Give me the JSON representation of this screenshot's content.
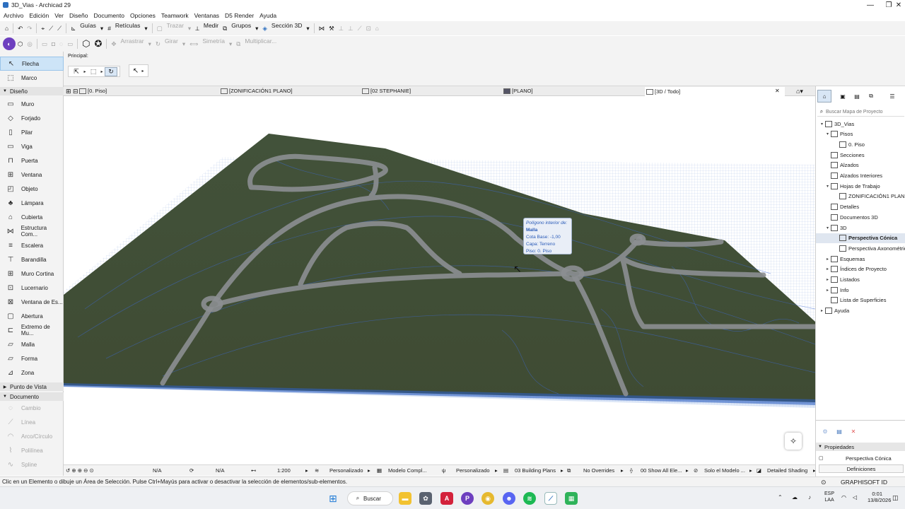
{
  "window": {
    "title": "3D_Vias - Archicad 29",
    "minimize_icon": "minimize-icon",
    "restore_icon": "restore-icon",
    "close_icon": "close-icon"
  },
  "menu": [
    "Archivo",
    "Edición",
    "Ver",
    "Diseño",
    "Documento",
    "Opciones",
    "Teamwork",
    "Ventanas",
    "D5 Render",
    "Ayuda"
  ],
  "toolbar1": {
    "guias": "Guías",
    "reticulas": "Retículas",
    "trazar": "Trazar",
    "medir": "Medir",
    "grupos": "Grupos",
    "seccion3d": "Sección 3D"
  },
  "toolbar2": {
    "arrastrar": "Arrastrar",
    "girar": "Girar",
    "simetria": "Simetría",
    "multiplicar": "Multiplicar..."
  },
  "infobox": {
    "label": "Principal:"
  },
  "toolbox": {
    "flecha": "Flecha",
    "marco": "Marco",
    "diseno_header": "Diseño",
    "design_tools": [
      "Muro",
      "Forjado",
      "Pilar",
      "Viga",
      "Puerta",
      "Ventana",
      "Objeto",
      "Lámpara",
      "Cubierta",
      "Estructura Com...",
      "Escalera",
      "Barandilla",
      "Muro Cortina",
      "Lucernario",
      "Ventana de Es...",
      "Abertura",
      "Extremo de Mu...",
      "Malla",
      "Forma",
      "Zona"
    ],
    "punto_header": "Punto de Vista",
    "documento_header": "Documento",
    "doc_tools": [
      "Cambio",
      "Línea",
      "Arco/Círculo",
      "Polilínea",
      "Spline"
    ]
  },
  "tabs": [
    "[0. Piso]",
    "[ZONIFICACIÓN1 PLANO]",
    "[02 STEPHANIE]",
    "[PLANO]",
    "[3D / Todo]"
  ],
  "tooltip": {
    "line1": "Polígono interior de:",
    "line2": "Malla",
    "line3": "Cota Base: -1,00",
    "line4": "Capa: Terreno",
    "line5": "Piso: 0. Piso"
  },
  "navigator": {
    "search_placeholder": "Buscar Mapa de Proyecto",
    "items": [
      {
        "label": "3D_Vias",
        "exp": "▾"
      },
      {
        "label": "Pisos",
        "exp": "▾"
      },
      {
        "label": "0. Piso",
        "exp": ""
      },
      {
        "label": "Secciones",
        "exp": ""
      },
      {
        "label": "Alzados",
        "exp": ""
      },
      {
        "label": "Alzados Interiores",
        "exp": ""
      },
      {
        "label": "Hojas de Trabajo",
        "exp": "▾"
      },
      {
        "label": "ZONIFICACIÓN1 PLANO (",
        "exp": ""
      },
      {
        "label": "Detalles",
        "exp": ""
      },
      {
        "label": "Documentos 3D",
        "exp": ""
      },
      {
        "label": "3D",
        "exp": "▾"
      },
      {
        "label": "Perspectiva Cónica",
        "exp": ""
      },
      {
        "label": "Perspectiva Axonométrica",
        "exp": ""
      },
      {
        "label": "Esquemas",
        "exp": "▸"
      },
      {
        "label": "Índices de Proyecto",
        "exp": "▸"
      },
      {
        "label": "Listados",
        "exp": "▸"
      },
      {
        "label": "Info",
        "exp": "▸"
      },
      {
        "label": "Lista de Superficies",
        "exp": ""
      },
      {
        "label": "Ayuda",
        "exp": "▸"
      }
    ],
    "properties_header": "Propiedades",
    "properties_value": "Perspectiva Cónica",
    "definitions": "Definiciones",
    "graphisoft_id": "GRAPHISOFT ID"
  },
  "viewcontrols": {
    "na1": "N/A",
    "na2": "N/A",
    "scale": "1:200",
    "pers1": "Personalizado",
    "modelo": "Modelo Compl...",
    "pers2": "Personalizado",
    "building": "03 Building Plans",
    "overrides": "No Overrides",
    "show": "00 Show All Ele...",
    "solo": "Solo el Modelo ...",
    "shading": "Detailed Shading"
  },
  "status": "Clic en un Elemento o dibuje un Área de Selección. Pulse Ctrl+Mayús para activar o desactivar la selección de elementos/sub-elementos.",
  "taskbar": {
    "search": "Buscar",
    "lang1": "ESP",
    "lang2": "LAA",
    "time": "0:01",
    "date": "13/8/2026"
  }
}
